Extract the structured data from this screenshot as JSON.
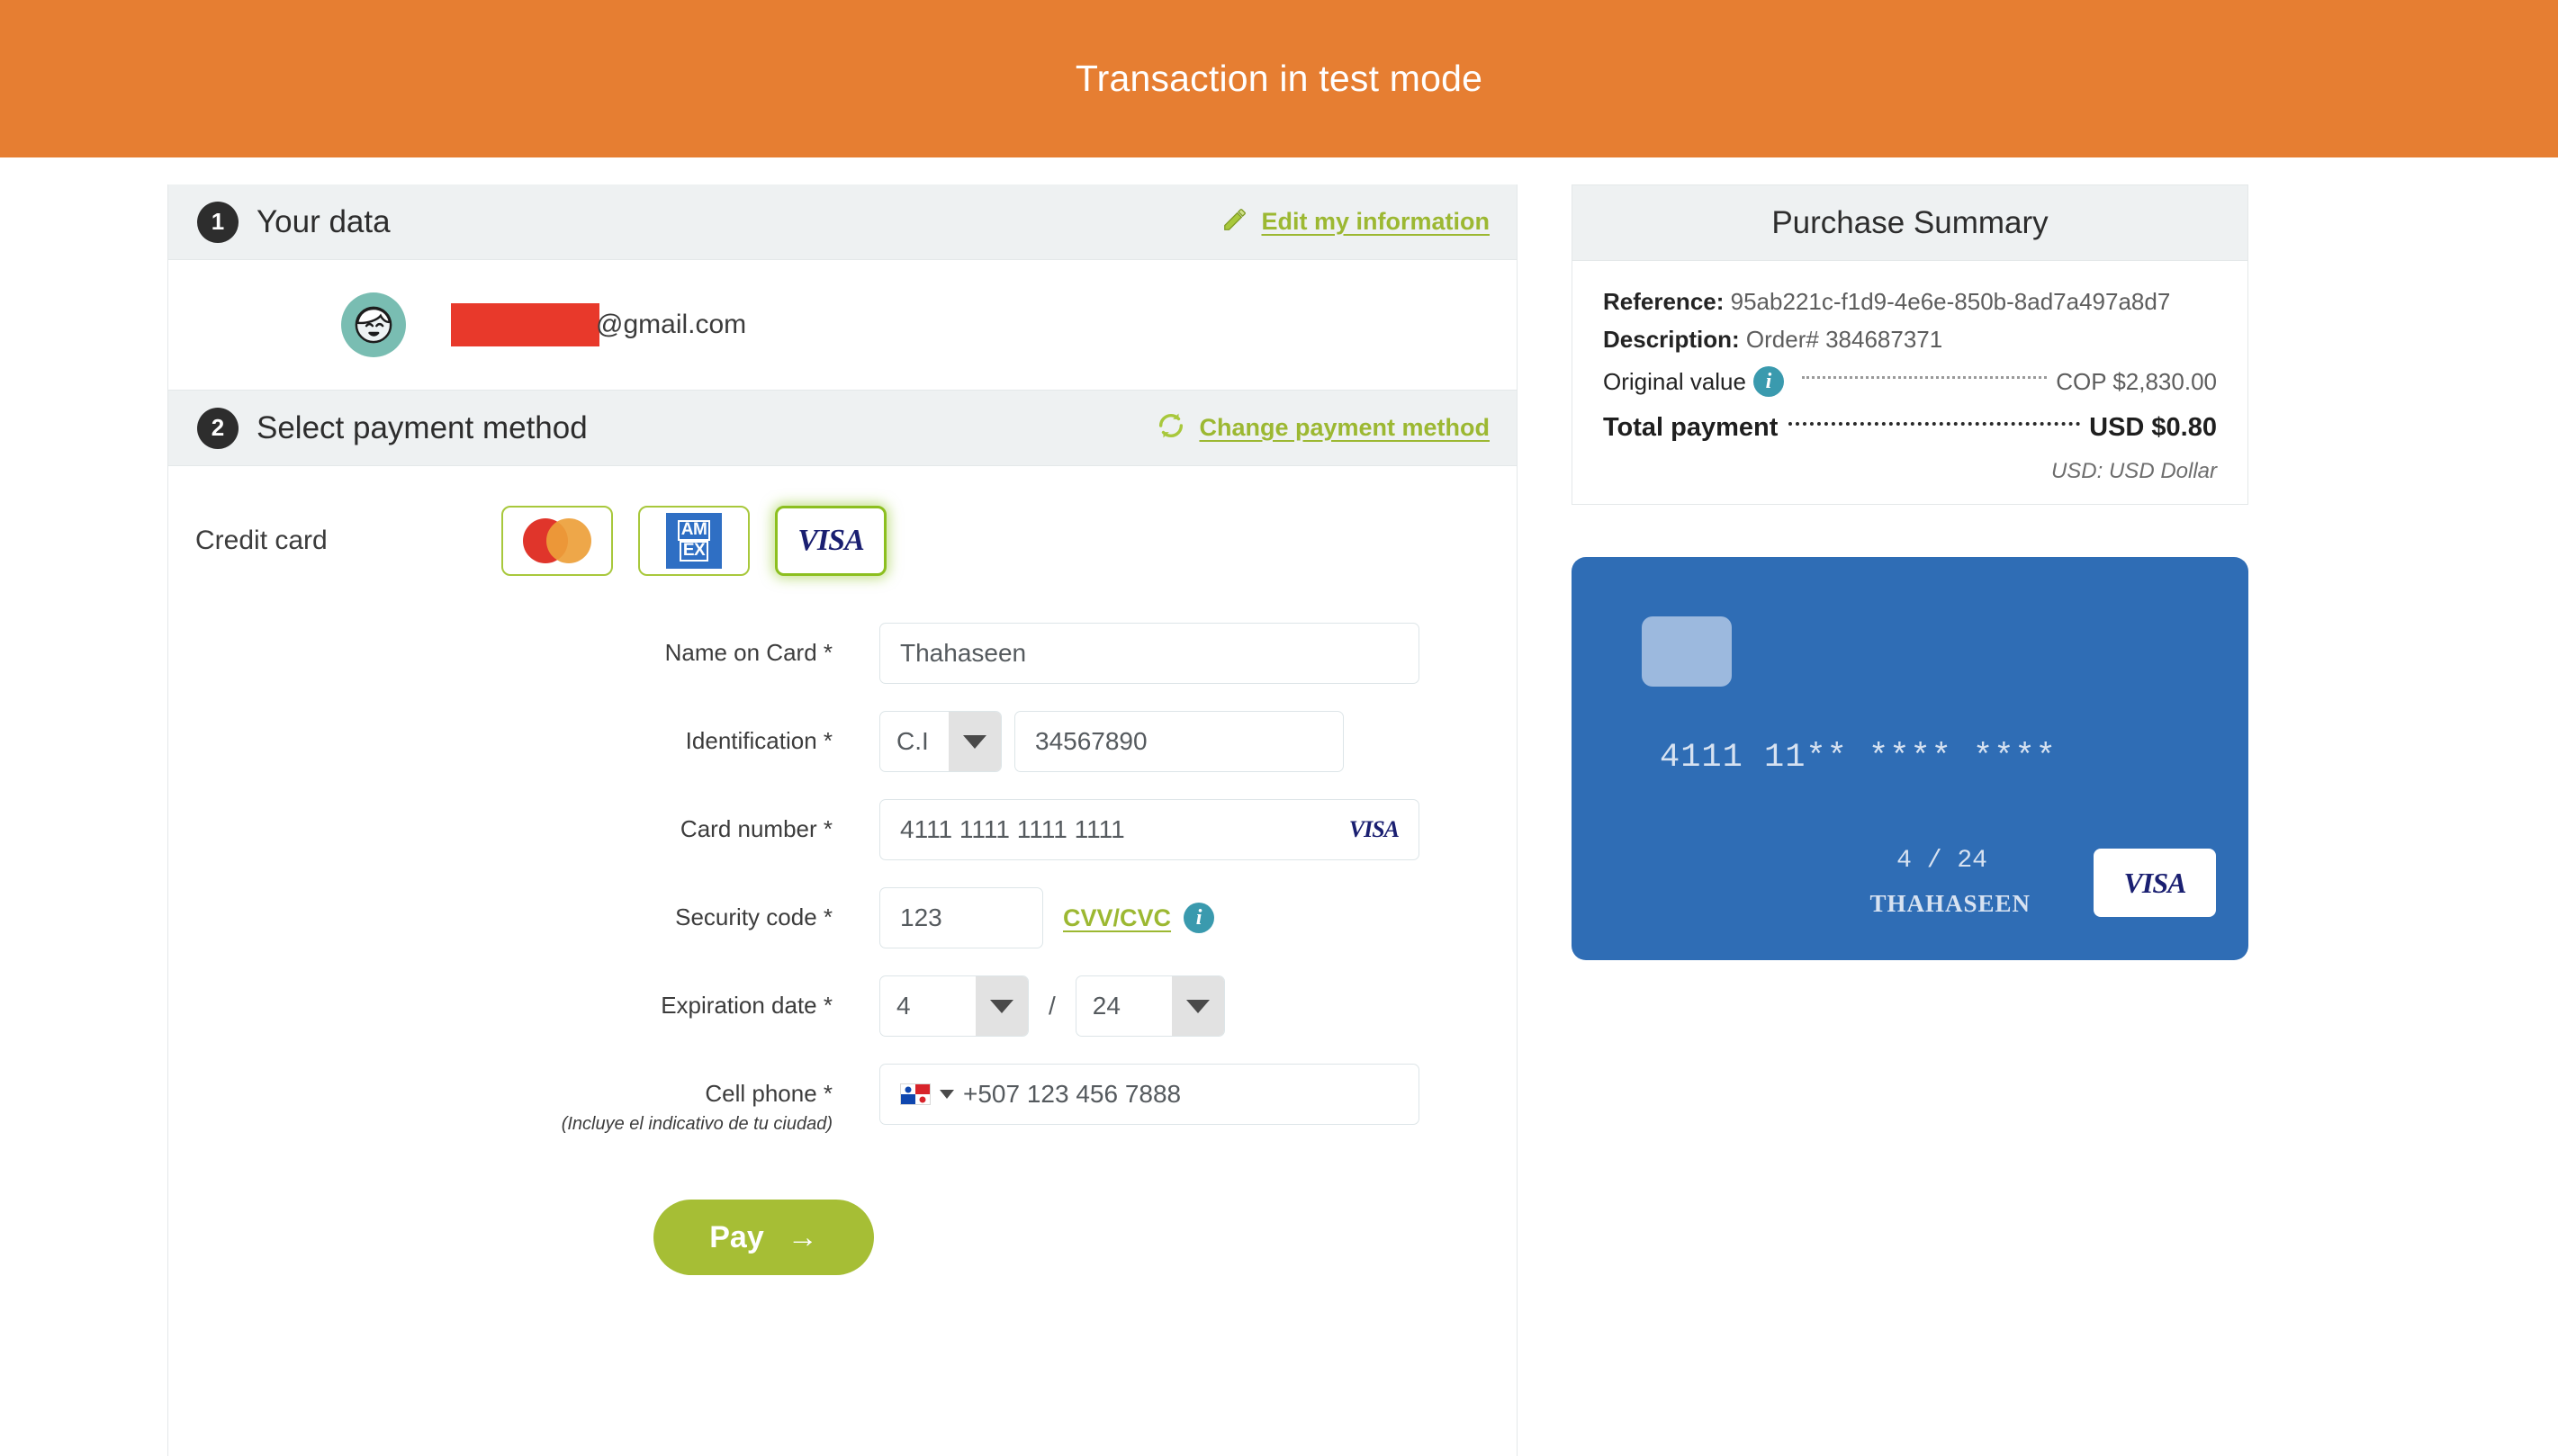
{
  "banner": {
    "text": "Transaction in test mode",
    "color": "#e67e32"
  },
  "theme": {
    "accent_green": "#9cb832",
    "pay_button_green": "#a6be35",
    "card_blue": "#2f6db5",
    "info_teal": "#3a9aae",
    "header_grey": "#eef1f2"
  },
  "step_one": {
    "number": "1",
    "title": "Your data",
    "action_label": "Edit my information",
    "action_icon": "pencil-icon",
    "avatar_icon": "user-avatar-icon",
    "email_redacted_visible": "@gmail.com"
  },
  "step_two": {
    "number": "2",
    "title": "Select payment method",
    "action_label": "Change payment method",
    "action_icon": "refresh-icon"
  },
  "payment_method": {
    "label": "Credit card",
    "brands": [
      {
        "name": "mastercard",
        "selected": false
      },
      {
        "name": "amex",
        "selected": false,
        "line1": "AM",
        "line2": "EX"
      },
      {
        "name": "visa",
        "selected": true,
        "wordmark": "VISA"
      }
    ]
  },
  "form": {
    "name_on_card": {
      "label": "Name on Card *",
      "value": "Thahaseen"
    },
    "identification": {
      "label": "Identification *",
      "type_value": "C.I",
      "number_value": "34567890"
    },
    "card_number": {
      "label": "Card number *",
      "value": "4111 1111 1111 1111",
      "brand_wordmark": "VISA"
    },
    "security_code": {
      "label": "Security code *",
      "value": "123",
      "help_link": "CVV/CVC",
      "info_icon": "info-icon"
    },
    "expiration": {
      "label": "Expiration date *",
      "month": "4",
      "separator": "/",
      "year": "24"
    },
    "cell_phone": {
      "label": "Cell phone *",
      "hint": "(Incluye el indicativo de tu ciudad)",
      "country_flag": "panama-flag-icon",
      "value": "+507 123 456 7888"
    },
    "pay_button": {
      "label": "Pay",
      "arrow": "→"
    }
  },
  "summary": {
    "title": "Purchase Summary",
    "reference_label": "Reference:",
    "reference_value": "95ab221c-f1d9-4e6e-850b-8ad7a497a8d7",
    "description_label": "Description:",
    "description_value": "Order# 384687371",
    "original_value_label": "Original value",
    "original_value_amount": "COP $2,830.00",
    "total_label": "Total payment",
    "total_amount": "USD $0.80",
    "currency_note": "USD: USD Dollar"
  },
  "card_preview": {
    "number": "4111 11** **** ****",
    "expiry": "4 / 24",
    "holder": "THAHASEEN",
    "brand_wordmark": "VISA"
  }
}
